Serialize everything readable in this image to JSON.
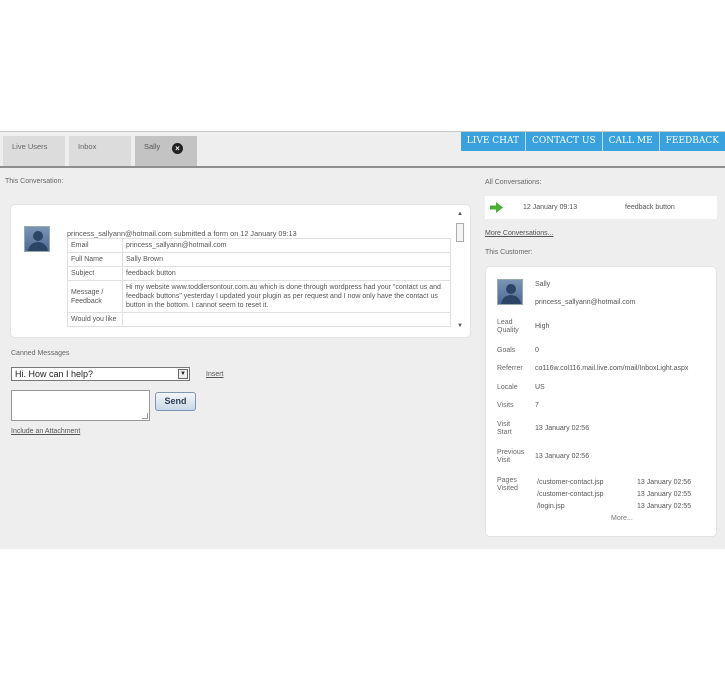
{
  "tabs": [
    {
      "label": "Live Users"
    },
    {
      "label": "Inbox"
    },
    {
      "label": "Sally",
      "active": true
    }
  ],
  "top_buttons": [
    "LIVE CHAT",
    "CONTACT US",
    "CALL ME",
    "FEEDBACK"
  ],
  "this_conversation_label": "This Conversation:",
  "conversation": {
    "submitted_text": "princess_sallyann@hotmail.com submitted a form on 12 January 09:13",
    "rows": [
      {
        "key": "Email",
        "value": "princess_sallyann@hotmail.com"
      },
      {
        "key": "Full Name",
        "value": "Sally Brown"
      },
      {
        "key": "Subject",
        "value": "feedback button"
      },
      {
        "key": "Message / Feedback",
        "value": "Hi my website www.toddlersontour.com.au which is done through wordpress had your \"contact us and feedback buttons\" yesterday I updated your plugin as per request and I now only have the contact us button in the bottom. I cannot seem to reset it."
      },
      {
        "key": "Would you like",
        "value": ""
      }
    ]
  },
  "canned": {
    "label": "Canned Messages",
    "selected": "Hi. How can I help?",
    "insert_link": "Insert",
    "send_label": "Send",
    "attachment_link": "Include an Attachment"
  },
  "all_conversations": {
    "label": "All Conversations:",
    "items": [
      {
        "date": "12 January 09:13",
        "subject": "feedback button"
      }
    ],
    "more_link": "More Conversations..."
  },
  "customer": {
    "label": "This Customer:",
    "name": "Sally",
    "email": "princess_sallyann@hotmail.com",
    "fields": {
      "lead_quality_label": "Lead Quality",
      "lead_quality": "High",
      "goals_label": "Goals",
      "goals": "0",
      "referrer_label": "Referrer",
      "referrer": "co116w.col116.mail.live.com/mail/InboxLight.aspx",
      "locale_label": "Locale",
      "locale": "US",
      "visits_label": "Visits",
      "visits": "7",
      "visit_start_label": "Visit Start",
      "visit_start": "13 January 02:56",
      "previous_visit_label": "Previous Visit",
      "previous_visit": "13 January 02:56",
      "pages_visited_label": "Pages Visited"
    },
    "pages": [
      {
        "path": "/customer-contact.jsp",
        "time": "13 January 02:56"
      },
      {
        "path": "/customer-contact.jsp",
        "time": "13 January 02:55"
      },
      {
        "path": "/login.jsp",
        "time": "13 January 02:55"
      }
    ],
    "more_link": "More..."
  },
  "colors": {
    "accent": "#39a2de",
    "panel_bg": "#eeeeee",
    "green_arrow": "#4caf35"
  },
  "icons": {
    "tab_close": "close-circle-icon",
    "conversation_arrow": "green-arrow-right-icon",
    "avatar": "user-silhouette-icon"
  }
}
